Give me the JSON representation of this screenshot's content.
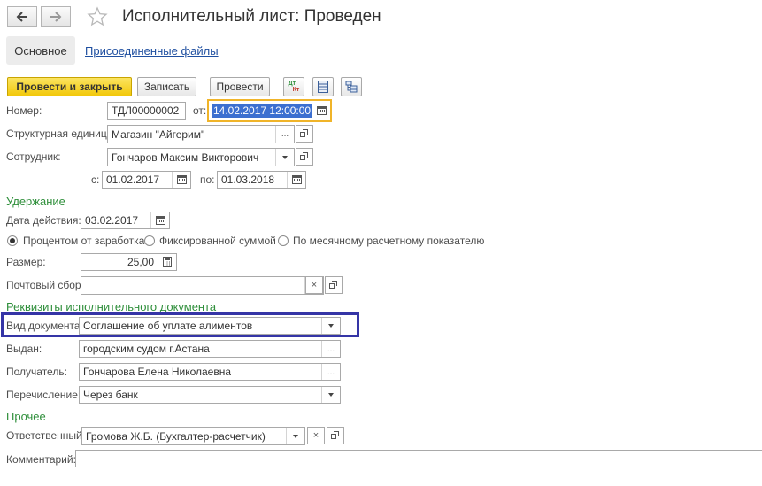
{
  "window": {
    "title": "Исполнительный лист: Проведен"
  },
  "tabs": {
    "main": "Основное",
    "files": "Присоединенные файлы"
  },
  "toolbar": {
    "post_close": "Провести и закрыть",
    "save": "Записать",
    "post": "Провести",
    "dtkt_top": "Дт",
    "dtkt_bottom": "Кт"
  },
  "header": {
    "number_label": "Номер:",
    "number_value": "ТДЛ00000002",
    "date_label": "от:",
    "date_value": "14.02.2017 12:00:00",
    "unit_label": "Структурная единица:",
    "unit_value": "Магазин \"Айгерим\"",
    "employee_label": "Сотрудник:",
    "employee_value": "Гончаров Максим Викторович",
    "period_from_label": "с:",
    "period_from": "01.02.2017",
    "period_to_label": "по:",
    "period_to": "01.03.2018"
  },
  "deduction": {
    "section_title": "Удержание",
    "date_label": "Дата действия:",
    "date_value": "03.02.2017",
    "radio_options": [
      "Процентом от заработка",
      "Фиксированной суммой",
      "По месячному расчетному показателю"
    ],
    "selected_option": "Процентом от заработка",
    "size_label": "Размер:",
    "size_value": "25,00",
    "postal_label": "Почтовый сбор:",
    "postal_value": ""
  },
  "document": {
    "section_title": "Реквизиты исполнительного документа",
    "kind_label": "Вид документа:",
    "kind_value": "Соглашение об уплате алиментов",
    "issued_label": "Выдан:",
    "issued_value": "городским судом г.Астана",
    "recipient_label": "Получатель:",
    "recipient_value": "Гончарова Елена Николаевна",
    "transfer_label": "Перечисление:",
    "transfer_value": "Через банк"
  },
  "other": {
    "section_title": "Прочее",
    "responsible_label": "Ответственный:",
    "responsible_value": "Громова Ж.Б. (Бухгалтер-расчетчик)",
    "comment_label": "Комментарий:",
    "comment_value": ""
  },
  "icons": {
    "back": "arrow-left-icon",
    "forward": "arrow-right-icon",
    "favorite": "star-icon",
    "calendar": "calendar-icon",
    "open": "open-icon",
    "dropdown": "chevron-down-icon",
    "clear": "close-icon",
    "select": "ellipsis-icon",
    "calculator": "calculator-icon"
  },
  "colors": {
    "primary_button": "#f2c80a",
    "section_title": "#2f8f3b",
    "link": "#1f4fa0",
    "date_focus_border": "#f0b429",
    "highlight_frame": "#3535a6",
    "selection": "#3c6fd0"
  }
}
